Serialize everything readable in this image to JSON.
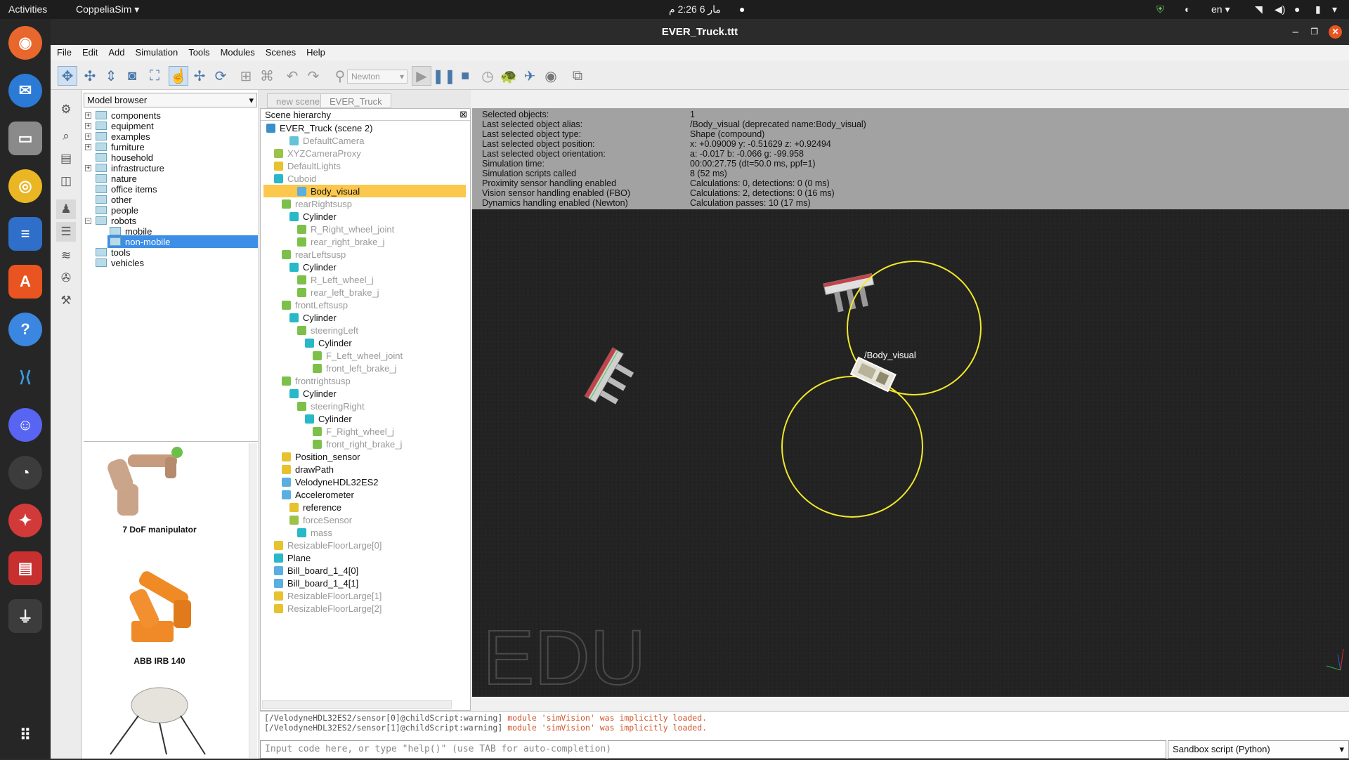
{
  "topbar": {
    "activities": "Activities",
    "app_name": "CoppeliaSim",
    "datetime": "مار 6 2:26 م",
    "lang": "en"
  },
  "window": {
    "title": "EVER_Truck.ttt"
  },
  "menu": [
    "File",
    "Edit",
    "Add",
    "Simulation",
    "Tools",
    "Modules",
    "Scenes",
    "Help"
  ],
  "toolbar": {
    "engine": "Newton"
  },
  "model_browser": {
    "header": "Model browser",
    "folders": [
      "components",
      "equipment",
      "examples",
      "furniture",
      "household",
      "infrastructure",
      "nature",
      "office items",
      "other",
      "people",
      "robots",
      "mobile",
      "non-mobile",
      "tools",
      "vehicles"
    ],
    "thumbnails": [
      "7 DoF manipulator",
      "ABB IRB 140"
    ]
  },
  "scene_tabs": [
    "new scene",
    "EVER_Truck"
  ],
  "hierarchy": {
    "header": "Scene hierarchy",
    "rows": [
      {
        "label": "EVER_Truck (scene 2)"
      },
      {
        "label": "DefaultCamera"
      },
      {
        "label": "XYZCameraProxy"
      },
      {
        "label": "DefaultLights"
      },
      {
        "label": "Cuboid"
      },
      {
        "label": "Body_visual"
      },
      {
        "label": "rearRightsusp"
      },
      {
        "label": "Cylinder"
      },
      {
        "label": "R_Right_wheel_joint"
      },
      {
        "label": "rear_right_brake_j"
      },
      {
        "label": "rearLeftsusp"
      },
      {
        "label": "Cylinder"
      },
      {
        "label": "R_Left_wheel_j"
      },
      {
        "label": "rear_left_brake_j"
      },
      {
        "label": "frontLeftsusp"
      },
      {
        "label": "Cylinder"
      },
      {
        "label": "steeringLeft"
      },
      {
        "label": "Cylinder"
      },
      {
        "label": "F_Left_wheel_joint"
      },
      {
        "label": "front_left_brake_j"
      },
      {
        "label": "frontrightsusp"
      },
      {
        "label": "Cylinder"
      },
      {
        "label": "steeringRight"
      },
      {
        "label": "Cylinder"
      },
      {
        "label": "F_Right_wheel_j"
      },
      {
        "label": "front_right_brake_j"
      },
      {
        "label": "Position_sensor"
      },
      {
        "label": "drawPath"
      },
      {
        "label": "VelodyneHDL32ES2"
      },
      {
        "label": "Accelerometer"
      },
      {
        "label": "reference"
      },
      {
        "label": "forceSensor"
      },
      {
        "label": "mass"
      },
      {
        "label": "ResizableFloorLarge[0]"
      },
      {
        "label": "Plane"
      },
      {
        "label": "Bill_board_1_4[0]"
      },
      {
        "label": "Bill_board_1_4[1]"
      },
      {
        "label": "ResizableFloorLarge[1]"
      },
      {
        "label": "ResizableFloorLarge[2]"
      }
    ]
  },
  "info": [
    {
      "label": "Selected objects:",
      "value": "1"
    },
    {
      "label": "Last selected object alias:",
      "value": "/Body_visual    (deprecated name:Body_visual)"
    },
    {
      "label": "Last selected object type:",
      "value": "Shape (compound)"
    },
    {
      "label": "Last selected object position:",
      "value": "x: +0.09009    y: -0.51629    z: +0.92494"
    },
    {
      "label": "Last selected object orientation:",
      "value": "a: -0.017    b: -0.066    g: -99.958"
    },
    {
      "label": "Simulation time:",
      "value": "00:00:27.75 (dt=50.0 ms, ppf=1)"
    },
    {
      "label": "Simulation scripts called",
      "value": "8 (52 ms)"
    },
    {
      "label": "Proximity sensor handling enabled",
      "value": "Calculations: 0, detections: 0 (0 ms)"
    },
    {
      "label": "Vision sensor handling enabled (FBO)",
      "value": "Calculations: 2, detections: 0 (16 ms)"
    },
    {
      "label": "Dynamics handling enabled (Newton)",
      "value": "Calculation passes: 10 (17 ms)"
    }
  ],
  "viewport": {
    "object_label": "/Body_visual",
    "watermark": "EDU"
  },
  "console": {
    "lines": [
      {
        "prefix": "[/VelodyneHDL32ES2/sensor[0]@childScript:warning]",
        "msg": "module 'simVision' was implicitly loaded."
      },
      {
        "prefix": "[/VelodyneHDL32ES2/sensor[1]@childScript:warning]",
        "msg": "module 'simVision' was implicitly loaded."
      }
    ],
    "input_placeholder": "Input code here, or type \"help()\" (use TAB for auto-completion)",
    "sandbox": "Sandbox script (Python)"
  }
}
